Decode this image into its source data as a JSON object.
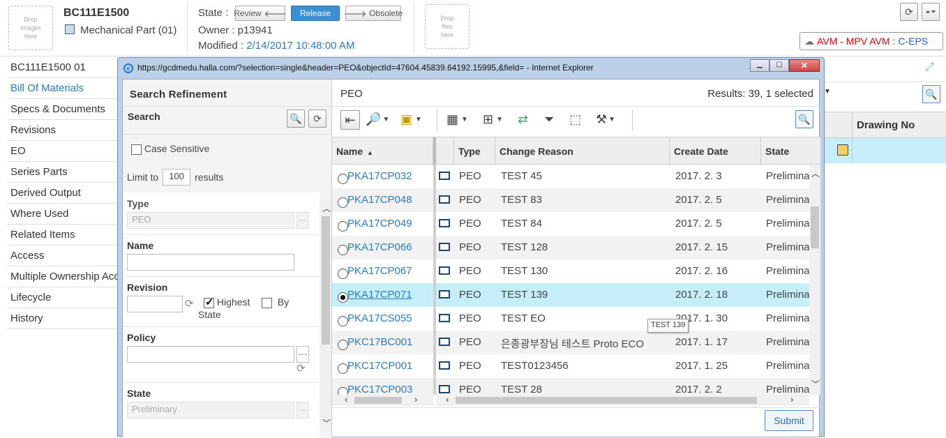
{
  "header": {
    "drop_images": "Drop\nimages\nhere",
    "drop_files": "Drop\nfiles\nhere",
    "part_name": "BC111E1500",
    "part_type": "Mechanical Part (01)",
    "state_label": "State :",
    "review_btn": "Review",
    "release_btn": "Release",
    "obsolete_btn": "Obsolete",
    "owner_text": "Owner : p13941",
    "modified_label": "Modified :",
    "modified_value": "2/14/2017 10:48:00 AM",
    "avm_red": "AVM - MPV AVM",
    "avm_sep": ":",
    "avm_blue": "C-EPS"
  },
  "sidebar": {
    "title": "BC111E1500 01",
    "items": [
      {
        "label": "Bill Of Materials"
      },
      {
        "label": "Specs & Documents"
      },
      {
        "label": "Revisions"
      },
      {
        "label": "EO"
      },
      {
        "label": "Series Parts"
      },
      {
        "label": "Derived Output"
      },
      {
        "label": "Where Used"
      },
      {
        "label": "Related Items"
      },
      {
        "label": "Access"
      },
      {
        "label": "Multiple Ownership Access"
      },
      {
        "label": "Lifecycle"
      },
      {
        "label": "History"
      }
    ]
  },
  "background_table": {
    "drawing_no": "Drawing No"
  },
  "popup": {
    "title": "https://gcdmedu.halla.com/?selection=single&header=PEO&objectId=47604.45839.64192.15995,&field= - Internet Explorer",
    "refine": {
      "title": "Search Refinement",
      "search_label": "Search",
      "case_sensitive": "Case Sensitive",
      "limit_to": "Limit to",
      "limit_value": "100",
      "results_word": "results",
      "type_label": "Type",
      "type_value": "PEO",
      "name_label": "Name",
      "revision_label": "Revision",
      "highest_label": "Highest",
      "by_label": "By",
      "state_word": "State",
      "policy_label": "Policy",
      "state_label": "State",
      "state_value": "Preliminary"
    },
    "results": {
      "title": "PEO",
      "summary": "Results: 39, 1 selected",
      "columns": [
        "Name",
        "Type",
        "Change Reason",
        "Create Date",
        "State"
      ],
      "rows": [
        {
          "name": "PKA17CP032",
          "type": "PEO",
          "reason": "TEST 45",
          "date": "2017. 2. 3",
          "state": "Preliminary"
        },
        {
          "name": "PKA17CP048",
          "type": "PEO",
          "reason": "TEST 83",
          "date": "2017. 2. 5",
          "state": "Preliminary"
        },
        {
          "name": "PKA17CP049",
          "type": "PEO",
          "reason": "TEST 84",
          "date": "2017. 2. 5",
          "state": "Preliminary"
        },
        {
          "name": "PKA17CP066",
          "type": "PEO",
          "reason": "TEST 128",
          "date": "2017. 2. 15",
          "state": "Preliminary"
        },
        {
          "name": "PKA17CP067",
          "type": "PEO",
          "reason": "TEST 130",
          "date": "2017. 2. 16",
          "state": "Preliminary"
        },
        {
          "name": "PKA17CP071",
          "type": "PEO",
          "reason": "TEST 139",
          "date": "2017. 2. 18",
          "state": "Preliminary"
        },
        {
          "name": "PKA17CS055",
          "type": "PEO",
          "reason": "TEST EO",
          "date": "2017. 1. 30",
          "state": "Preliminary"
        },
        {
          "name": "PKC17BC001",
          "type": "PEO",
          "reason": "은종광부장님 테스트 Proto ECO",
          "date": "2017. 1. 17",
          "state": "Preliminary"
        },
        {
          "name": "PKC17CP001",
          "type": "PEO",
          "reason": "TEST0123456",
          "date": "2017. 1. 25",
          "state": "Preliminary"
        },
        {
          "name": "PKC17CP003",
          "type": "PEO",
          "reason": "TEST 28",
          "date": "2017. 2. 2",
          "state": "Preliminary"
        }
      ],
      "tooltip": "TEST 139",
      "submit": "Submit"
    }
  }
}
